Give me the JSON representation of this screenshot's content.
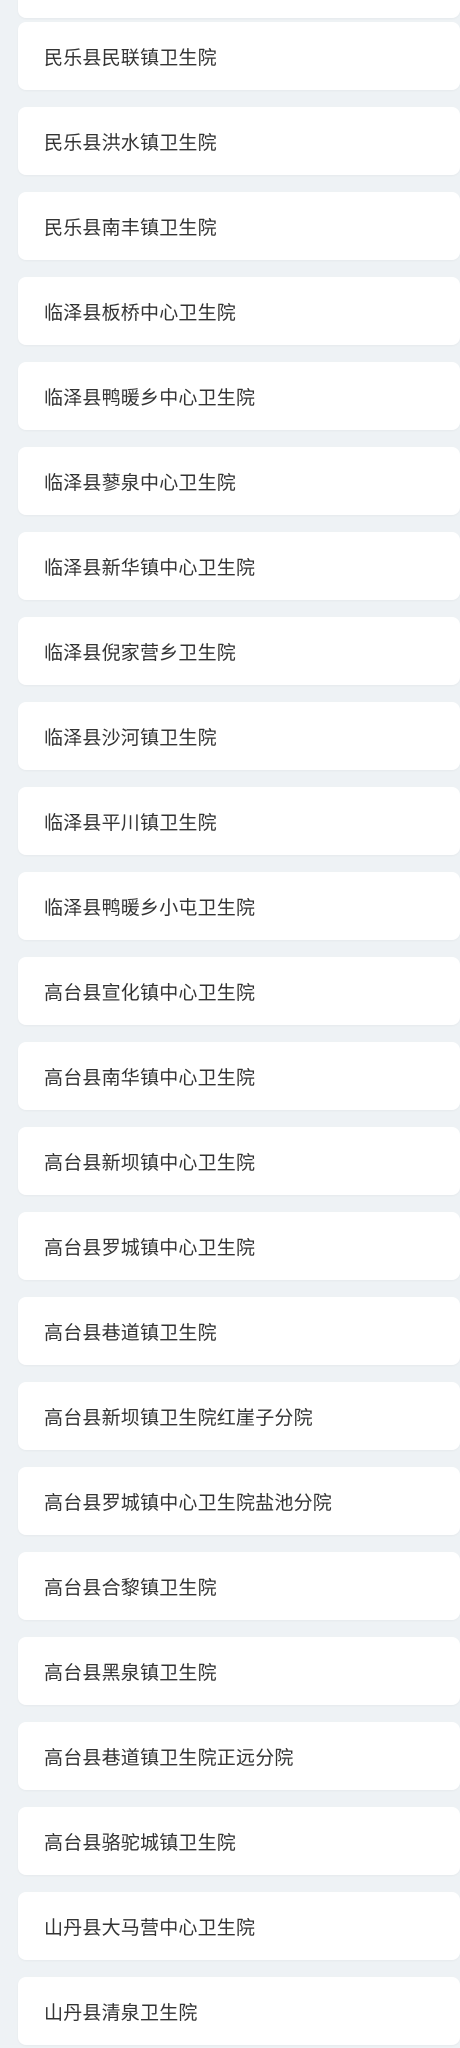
{
  "hospital_list": {
    "items": [
      {
        "name": "民乐县民联镇卫生院"
      },
      {
        "name": "民乐县洪水镇卫生院"
      },
      {
        "name": "民乐县南丰镇卫生院"
      },
      {
        "name": "临泽县板桥中心卫生院"
      },
      {
        "name": "临泽县鸭暖乡中心卫生院"
      },
      {
        "name": "临泽县蓼泉中心卫生院"
      },
      {
        "name": "临泽县新华镇中心卫生院"
      },
      {
        "name": "临泽县倪家营乡卫生院"
      },
      {
        "name": "临泽县沙河镇卫生院"
      },
      {
        "name": "临泽县平川镇卫生院"
      },
      {
        "name": "临泽县鸭暖乡小屯卫生院"
      },
      {
        "name": "高台县宣化镇中心卫生院"
      },
      {
        "name": "高台县南华镇中心卫生院"
      },
      {
        "name": "高台县新坝镇中心卫生院"
      },
      {
        "name": "高台县罗城镇中心卫生院"
      },
      {
        "name": "高台县巷道镇卫生院"
      },
      {
        "name": "高台县新坝镇卫生院红崖子分院"
      },
      {
        "name": "高台县罗城镇中心卫生院盐池分院"
      },
      {
        "name": "高台县合黎镇卫生院"
      },
      {
        "name": "高台县黑泉镇卫生院"
      },
      {
        "name": "高台县巷道镇卫生院正远分院"
      },
      {
        "name": "高台县骆驼城镇卫生院"
      },
      {
        "name": "山丹县大马营中心卫生院"
      },
      {
        "name": "山丹县清泉卫生院"
      }
    ]
  }
}
